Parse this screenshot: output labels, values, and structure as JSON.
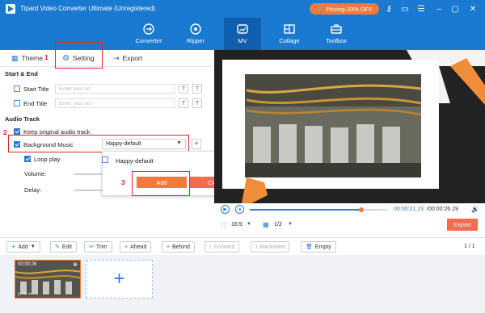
{
  "app": {
    "title": "Tipard Video Converter Ultimate (Unregistered)",
    "promo": "Pricing-20% OFF"
  },
  "nav": [
    {
      "label": "Converter",
      "icon": "converter-icon"
    },
    {
      "label": "Ripper",
      "icon": "ripper-icon"
    },
    {
      "label": "MV",
      "icon": "mv-icon",
      "active": true
    },
    {
      "label": "Collage",
      "icon": "collage-icon"
    },
    {
      "label": "Toolbox",
      "icon": "toolbox-icon"
    }
  ],
  "tabs": {
    "theme": "Theme",
    "setting": "Setting",
    "export": "Export"
  },
  "annotations": {
    "n1": "1",
    "n2": "2",
    "n3": "3"
  },
  "start_end": {
    "heading": "Start & End",
    "start_title": {
      "label": "Start Title",
      "placeholder": "Enter your txt",
      "checked": false
    },
    "end_title": {
      "label": "End Title",
      "placeholder": "Enter your txt",
      "checked": false
    }
  },
  "audio": {
    "heading": "Audio Track",
    "keep_original": {
      "label": "Keep original audio track",
      "checked": true
    },
    "background_music": {
      "label": "Background Music",
      "value": "Happy-default",
      "checked": true
    },
    "loop_play": {
      "label": "Loop play",
      "checked": true
    },
    "volume_label": "Volume:",
    "delay_label": "Delay:"
  },
  "popup": {
    "option": "Happy-default",
    "add": "Add",
    "clear": "Clear"
  },
  "player": {
    "current_time": "00:00:21.23",
    "total_time": "/00:00:26.19",
    "aspect": "16:9",
    "scale": "1/2",
    "export": "Export",
    "progress": 0.81
  },
  "toolbar": {
    "add": "Add",
    "edit": "Edit",
    "trim": "Trim",
    "ahead": "Ahead",
    "behind": "Behind",
    "forward": "Forward",
    "backward": "Backward",
    "empty": "Empty",
    "page": "1 / 1"
  },
  "clip": {
    "duration": "00:00:26"
  },
  "colors": {
    "header": "#1a79d0",
    "accent": "#f07a3c",
    "annotation": "#e0242f"
  }
}
